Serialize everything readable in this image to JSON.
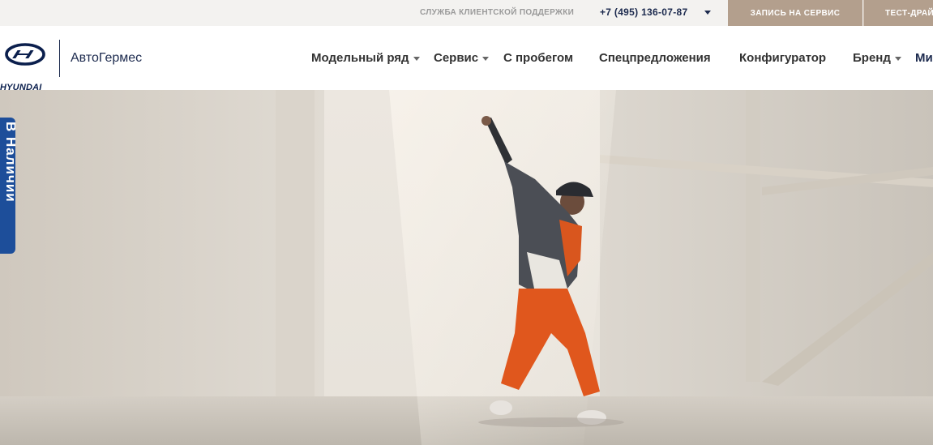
{
  "topbar": {
    "support_label": "СЛУЖБА КЛИЕНТСКОЙ ПОДДЕРЖКИ",
    "phone": "+7 (495) 136-07-87",
    "service_button": "ЗАПИСЬ НА СЕРВИС",
    "testdrive_button": "ТЕСТ-ДРАЙ"
  },
  "header": {
    "brand": "HYUNDAI",
    "dealer": "АвтоГермес",
    "nav": [
      {
        "label": "Модельный ряд"
      },
      {
        "label": "Сервис"
      },
      {
        "label": "С пробегом"
      },
      {
        "label": "Спецпредложения"
      },
      {
        "label": "Конфигуратор"
      },
      {
        "label": "Бренд"
      }
    ],
    "nav_more": "Ми"
  },
  "side_tab": {
    "label": "В Наличии"
  },
  "colors": {
    "brand_navy": "#1c2a4e",
    "cta_beige": "#b39f8d",
    "side_tab_blue": "#1d4e9a"
  }
}
